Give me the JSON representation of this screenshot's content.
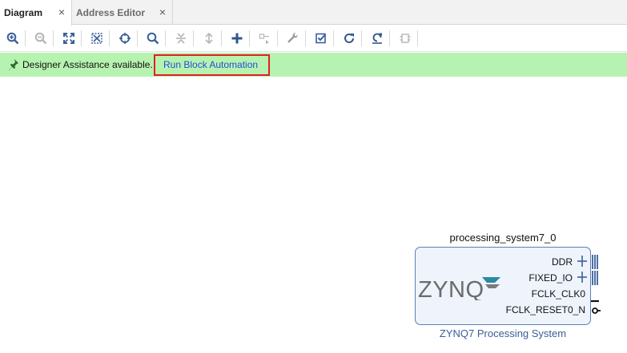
{
  "tabs": [
    {
      "label": "Diagram",
      "active": true
    },
    {
      "label": "Address Editor",
      "active": false
    }
  ],
  "toolbar": {
    "buttons": [
      "zoom-in-icon",
      "zoom-out-icon",
      "zoom-fit-icon",
      "fit-selection-icon",
      "autofit-selection-icon",
      "search-icon",
      "collapse-all-icon",
      "expand-all-icon",
      "add-ip-icon",
      "make-connection-icon",
      "properties-icon",
      "validate-design-icon",
      "regenerate-layout-icon",
      "optimize-routing-icon",
      "create-comment-icon"
    ]
  },
  "assistance": {
    "message": "Designer Assistance available.",
    "link": "Run Block Automation",
    "background": "#b7f3b0",
    "highlight_color": "#e02020"
  },
  "block": {
    "instance_name": "processing_system7_0",
    "logo_text": "ZYNQ",
    "subtitle": "ZYNQ7 Processing System",
    "ports": [
      {
        "name": "DDR",
        "kind": "bus"
      },
      {
        "name": "FIXED_IO",
        "kind": "bus"
      },
      {
        "name": "FCLK_CLK0",
        "kind": "output"
      },
      {
        "name": "FCLK_RESET0_N",
        "kind": "output-inverted"
      }
    ],
    "border_color": "#5d80b5",
    "fill_color": "#eef3fc"
  }
}
